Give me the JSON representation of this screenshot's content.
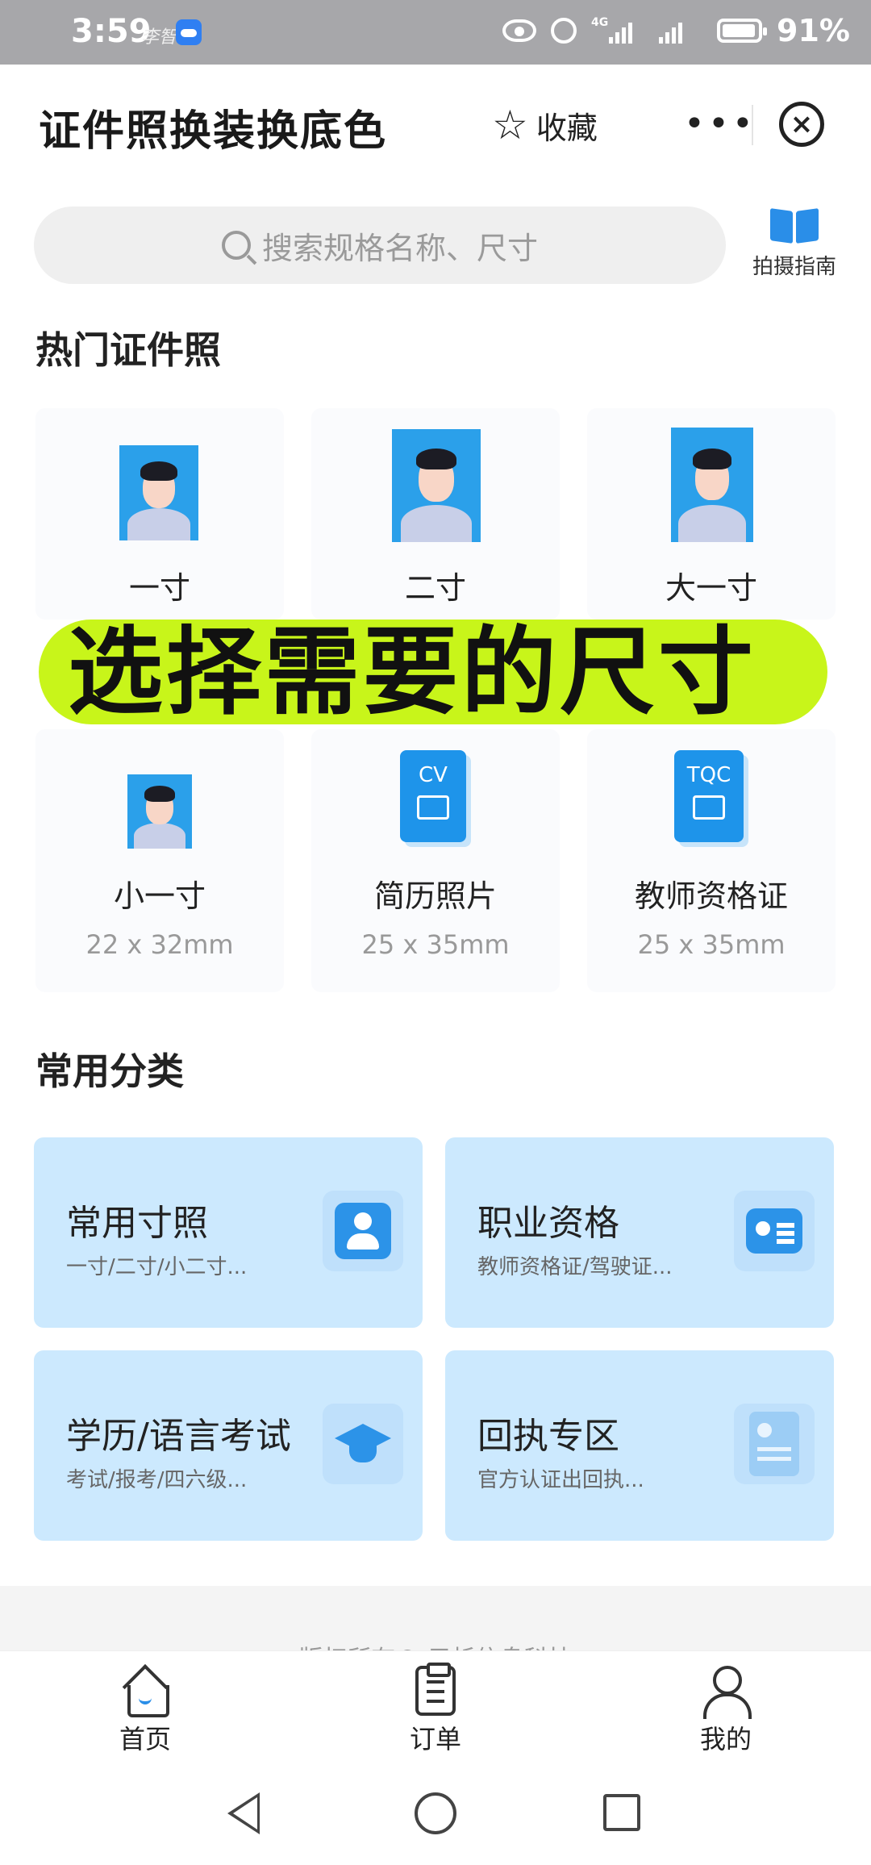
{
  "status_bar": {
    "time": "3:59",
    "small_text": "李智",
    "battery": "91%",
    "network": "4G"
  },
  "header": {
    "title": "证件照换装换底色",
    "favorite_label": "收藏",
    "more_label": "•••",
    "close_label": "×"
  },
  "search": {
    "placeholder": "搜索规格名称、尺寸",
    "guide_label": "拍摄指南"
  },
  "hot_section": {
    "title": "热门证件照",
    "items": [
      {
        "name": "一寸",
        "size": "",
        "icon": "portrait-icon"
      },
      {
        "name": "二寸",
        "size": "",
        "icon": "portrait-icon"
      },
      {
        "name": "大一寸",
        "size": "",
        "icon": "portrait-icon"
      },
      {
        "name": "小一寸",
        "size": "22 x 32mm",
        "icon": "portrait-icon"
      },
      {
        "name": "简历照片",
        "size": "25 x 35mm",
        "icon": "cv-icon",
        "icon_text": "CV"
      },
      {
        "name": "教师资格证",
        "size": "25 x 35mm",
        "icon": "tqc-icon",
        "icon_text": "TQC"
      }
    ]
  },
  "overlay_banner": {
    "text": "选择需要的尺寸",
    "color": "#c8f51a"
  },
  "category_section": {
    "title": "常用分类",
    "items": [
      {
        "name": "常用寸照",
        "sub": "一寸/二寸/小二寸...",
        "icon": "person-card-icon"
      },
      {
        "name": "职业资格",
        "sub": "教师资格证/驾驶证...",
        "icon": "id-badge-icon"
      },
      {
        "name": "学历/语言考试",
        "sub": "考试/报考/四六级...",
        "icon": "graduation-cap-icon"
      },
      {
        "name": "回执专区",
        "sub": "官方认证出回执...",
        "icon": "receipt-icon"
      }
    ]
  },
  "footer": {
    "copyright": "版权所有© 元析信息科技"
  },
  "tab_bar": {
    "tabs": [
      {
        "label": "首页",
        "icon": "home-icon",
        "active": true
      },
      {
        "label": "订单",
        "icon": "order-icon",
        "active": false
      },
      {
        "label": "我的",
        "icon": "user-icon",
        "active": false
      }
    ]
  },
  "colors": {
    "accent": "#2a8ee8",
    "category_bg": "#cce9fe",
    "portrait_bg": "#2ba0ea"
  }
}
